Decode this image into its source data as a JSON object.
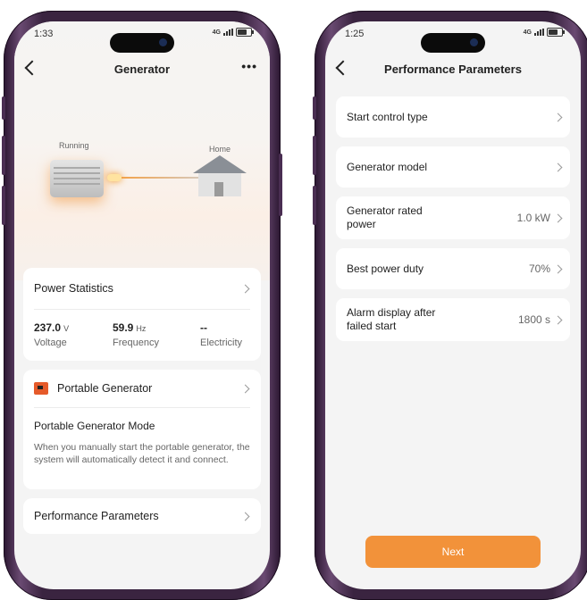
{
  "left": {
    "status": {
      "time": "1:33",
      "network": "4G"
    },
    "title": "Generator",
    "more_label": "•••",
    "hero": {
      "running_label": "Running",
      "home_label": "Home"
    },
    "power_stats": {
      "title": "Power Statistics",
      "items": [
        {
          "value": "237.0",
          "unit": "V",
          "label": "Voltage"
        },
        {
          "value": "59.9",
          "unit": "Hz",
          "label": "Frequency"
        },
        {
          "value": "--",
          "unit": "",
          "label": "Electricity"
        }
      ]
    },
    "portable": {
      "title": "Portable Generator",
      "mode_title": "Portable Generator Mode",
      "description": "When you manually start the portable generator, the system will automatically detect it and connect."
    },
    "performance_label": "Performance Parameters"
  },
  "right": {
    "status": {
      "time": "1:25",
      "network": "4G"
    },
    "title": "Performance Parameters",
    "rows": [
      {
        "label": "Start control type",
        "value": ""
      },
      {
        "label": "Generator model",
        "value": ""
      },
      {
        "label": "Generator rated power",
        "value": "1.0 kW"
      },
      {
        "label": "Best power duty",
        "value": "70%"
      },
      {
        "label": "Alarm display after failed start",
        "value": "1800 s"
      }
    ],
    "next_label": "Next"
  },
  "colors": {
    "accent": "#f2923a",
    "icon_orange": "#e55a2a",
    "frame": "#3a2440"
  }
}
